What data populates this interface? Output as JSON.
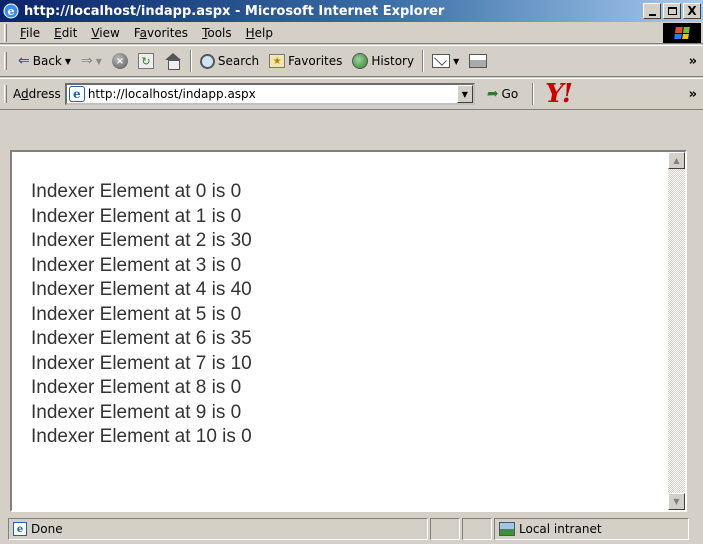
{
  "window": {
    "title": "http://localhost/indapp.aspx - Microsoft Internet Explorer",
    "close_glyph": "X"
  },
  "menu": {
    "items": [
      {
        "label_pre": "",
        "key": "F",
        "label_post": "ile"
      },
      {
        "label_pre": "",
        "key": "E",
        "label_post": "dit"
      },
      {
        "label_pre": "",
        "key": "V",
        "label_post": "iew"
      },
      {
        "label_pre": "F",
        "key": "a",
        "label_post": "vorites"
      },
      {
        "label_pre": "",
        "key": "T",
        "label_post": "ools"
      },
      {
        "label_pre": "",
        "key": "H",
        "label_post": "elp"
      }
    ]
  },
  "toolbar": {
    "back_label": "Back",
    "search_label": "Search",
    "favorites_label": "Favorites",
    "history_label": "History",
    "more_glyph": "»"
  },
  "address": {
    "label_pre": "A",
    "label_key": "d",
    "label_post": "dress",
    "url": "http://localhost/indapp.aspx",
    "go_label": "Go",
    "more_glyph": "»"
  },
  "content": {
    "lines": [
      "Indexer Element at 0 is 0",
      "Indexer Element at 1 is 0",
      "Indexer Element at 2 is 30",
      "Indexer Element at 3 is 0",
      "Indexer Element at 4 is 40",
      "Indexer Element at 5 is 0",
      "Indexer Element at 6 is 35",
      "Indexer Element at 7 is 10",
      "Indexer Element at 8 is 0",
      "Indexer Element at 9 is 0",
      "Indexer Element at 10 is 0"
    ]
  },
  "status": {
    "text": "Done",
    "zone": "Local intranet"
  }
}
